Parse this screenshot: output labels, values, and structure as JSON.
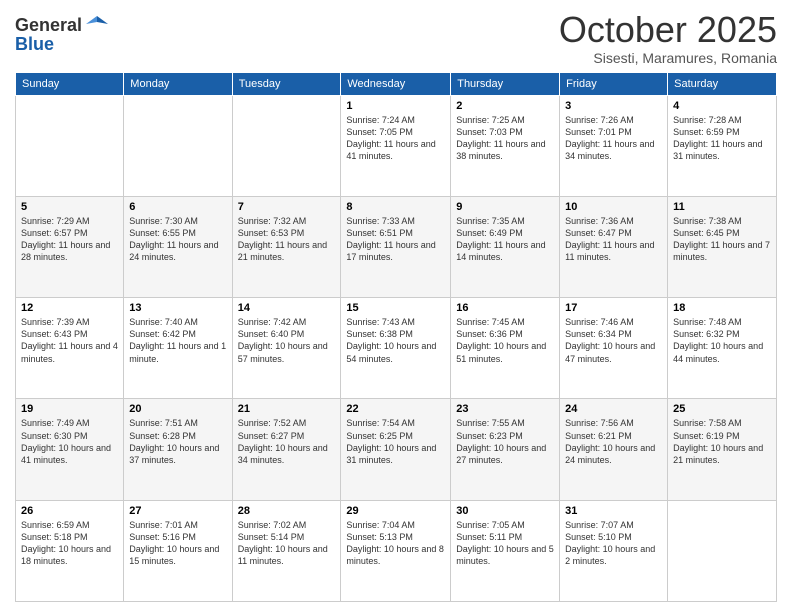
{
  "logo": {
    "general": "General",
    "blue": "Blue"
  },
  "header": {
    "month": "October 2025",
    "location": "Sisesti, Maramures, Romania"
  },
  "days_of_week": [
    "Sunday",
    "Monday",
    "Tuesday",
    "Wednesday",
    "Thursday",
    "Friday",
    "Saturday"
  ],
  "weeks": [
    [
      {
        "day": "",
        "info": ""
      },
      {
        "day": "",
        "info": ""
      },
      {
        "day": "",
        "info": ""
      },
      {
        "day": "1",
        "info": "Sunrise: 7:24 AM\nSunset: 7:05 PM\nDaylight: 11 hours\nand 41 minutes."
      },
      {
        "day": "2",
        "info": "Sunrise: 7:25 AM\nSunset: 7:03 PM\nDaylight: 11 hours\nand 38 minutes."
      },
      {
        "day": "3",
        "info": "Sunrise: 7:26 AM\nSunset: 7:01 PM\nDaylight: 11 hours\nand 34 minutes."
      },
      {
        "day": "4",
        "info": "Sunrise: 7:28 AM\nSunset: 6:59 PM\nDaylight: 11 hours\nand 31 minutes."
      }
    ],
    [
      {
        "day": "5",
        "info": "Sunrise: 7:29 AM\nSunset: 6:57 PM\nDaylight: 11 hours\nand 28 minutes."
      },
      {
        "day": "6",
        "info": "Sunrise: 7:30 AM\nSunset: 6:55 PM\nDaylight: 11 hours\nand 24 minutes."
      },
      {
        "day": "7",
        "info": "Sunrise: 7:32 AM\nSunset: 6:53 PM\nDaylight: 11 hours\nand 21 minutes."
      },
      {
        "day": "8",
        "info": "Sunrise: 7:33 AM\nSunset: 6:51 PM\nDaylight: 11 hours\nand 17 minutes."
      },
      {
        "day": "9",
        "info": "Sunrise: 7:35 AM\nSunset: 6:49 PM\nDaylight: 11 hours\nand 14 minutes."
      },
      {
        "day": "10",
        "info": "Sunrise: 7:36 AM\nSunset: 6:47 PM\nDaylight: 11 hours\nand 11 minutes."
      },
      {
        "day": "11",
        "info": "Sunrise: 7:38 AM\nSunset: 6:45 PM\nDaylight: 11 hours\nand 7 minutes."
      }
    ],
    [
      {
        "day": "12",
        "info": "Sunrise: 7:39 AM\nSunset: 6:43 PM\nDaylight: 11 hours\nand 4 minutes."
      },
      {
        "day": "13",
        "info": "Sunrise: 7:40 AM\nSunset: 6:42 PM\nDaylight: 11 hours\nand 1 minute."
      },
      {
        "day": "14",
        "info": "Sunrise: 7:42 AM\nSunset: 6:40 PM\nDaylight: 10 hours\nand 57 minutes."
      },
      {
        "day": "15",
        "info": "Sunrise: 7:43 AM\nSunset: 6:38 PM\nDaylight: 10 hours\nand 54 minutes."
      },
      {
        "day": "16",
        "info": "Sunrise: 7:45 AM\nSunset: 6:36 PM\nDaylight: 10 hours\nand 51 minutes."
      },
      {
        "day": "17",
        "info": "Sunrise: 7:46 AM\nSunset: 6:34 PM\nDaylight: 10 hours\nand 47 minutes."
      },
      {
        "day": "18",
        "info": "Sunrise: 7:48 AM\nSunset: 6:32 PM\nDaylight: 10 hours\nand 44 minutes."
      }
    ],
    [
      {
        "day": "19",
        "info": "Sunrise: 7:49 AM\nSunset: 6:30 PM\nDaylight: 10 hours\nand 41 minutes."
      },
      {
        "day": "20",
        "info": "Sunrise: 7:51 AM\nSunset: 6:28 PM\nDaylight: 10 hours\nand 37 minutes."
      },
      {
        "day": "21",
        "info": "Sunrise: 7:52 AM\nSunset: 6:27 PM\nDaylight: 10 hours\nand 34 minutes."
      },
      {
        "day": "22",
        "info": "Sunrise: 7:54 AM\nSunset: 6:25 PM\nDaylight: 10 hours\nand 31 minutes."
      },
      {
        "day": "23",
        "info": "Sunrise: 7:55 AM\nSunset: 6:23 PM\nDaylight: 10 hours\nand 27 minutes."
      },
      {
        "day": "24",
        "info": "Sunrise: 7:56 AM\nSunset: 6:21 PM\nDaylight: 10 hours\nand 24 minutes."
      },
      {
        "day": "25",
        "info": "Sunrise: 7:58 AM\nSunset: 6:19 PM\nDaylight: 10 hours\nand 21 minutes."
      }
    ],
    [
      {
        "day": "26",
        "info": "Sunrise: 6:59 AM\nSunset: 5:18 PM\nDaylight: 10 hours\nand 18 minutes."
      },
      {
        "day": "27",
        "info": "Sunrise: 7:01 AM\nSunset: 5:16 PM\nDaylight: 10 hours\nand 15 minutes."
      },
      {
        "day": "28",
        "info": "Sunrise: 7:02 AM\nSunset: 5:14 PM\nDaylight: 10 hours\nand 11 minutes."
      },
      {
        "day": "29",
        "info": "Sunrise: 7:04 AM\nSunset: 5:13 PM\nDaylight: 10 hours\nand 8 minutes."
      },
      {
        "day": "30",
        "info": "Sunrise: 7:05 AM\nSunset: 5:11 PM\nDaylight: 10 hours\nand 5 minutes."
      },
      {
        "day": "31",
        "info": "Sunrise: 7:07 AM\nSunset: 5:10 PM\nDaylight: 10 hours\nand 2 minutes."
      },
      {
        "day": "",
        "info": ""
      }
    ]
  ]
}
